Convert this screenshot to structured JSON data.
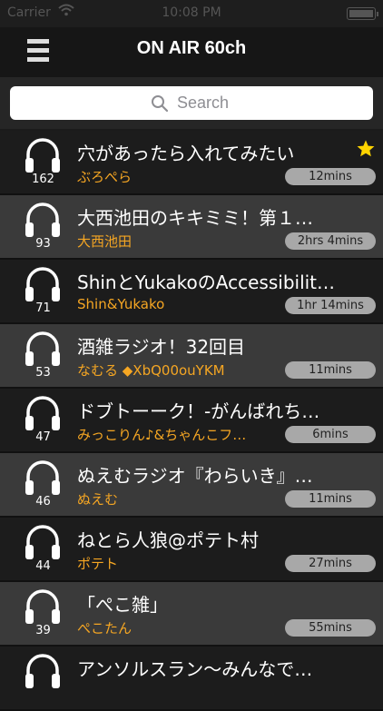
{
  "status_bar": {
    "carrier": "Carrier",
    "time": "10:08 PM"
  },
  "nav": {
    "title": "ON AIR 60ch"
  },
  "search": {
    "placeholder": "Search"
  },
  "colors": {
    "author": "#f5a623",
    "star": "#ffd400",
    "badge": "#a8a8a8"
  },
  "rows": [
    {
      "count": "162",
      "title": "穴があったら入れてみたい",
      "author": "ぶろぺら",
      "duration": "12mins",
      "starred": true
    },
    {
      "count": "93",
      "title": "大西池田のキキミミ！第１…",
      "author": "大西池田",
      "duration": "2hrs 4mins"
    },
    {
      "count": "71",
      "title": "ShinとYukakoのAccessibilit…",
      "author": "Shin&Yukako",
      "duration": "1hr 14mins"
    },
    {
      "count": "53",
      "title": "酒雑ラジオ！32回目",
      "author": "なむる ◆XbQ00ouYKM",
      "duration": "11mins"
    },
    {
      "count": "47",
      "title": "ドブトーーク！-がんばれち…",
      "author": "みっこりん♪&ちゃんこフ…",
      "duration": "6mins"
    },
    {
      "count": "46",
      "title": "ぬえむラジオ『わらいき』…",
      "author": "ぬえむ",
      "duration": "11mins"
    },
    {
      "count": "44",
      "title": "ねとら人狼@ポテト村",
      "author": "ポテト",
      "duration": "27mins"
    },
    {
      "count": "39",
      "title": "「ぺこ雑」",
      "author": "ぺこたん",
      "duration": "55mins"
    },
    {
      "count": "",
      "title": "アンソルスラン～みんなで…",
      "author": "",
      "duration": ""
    }
  ]
}
